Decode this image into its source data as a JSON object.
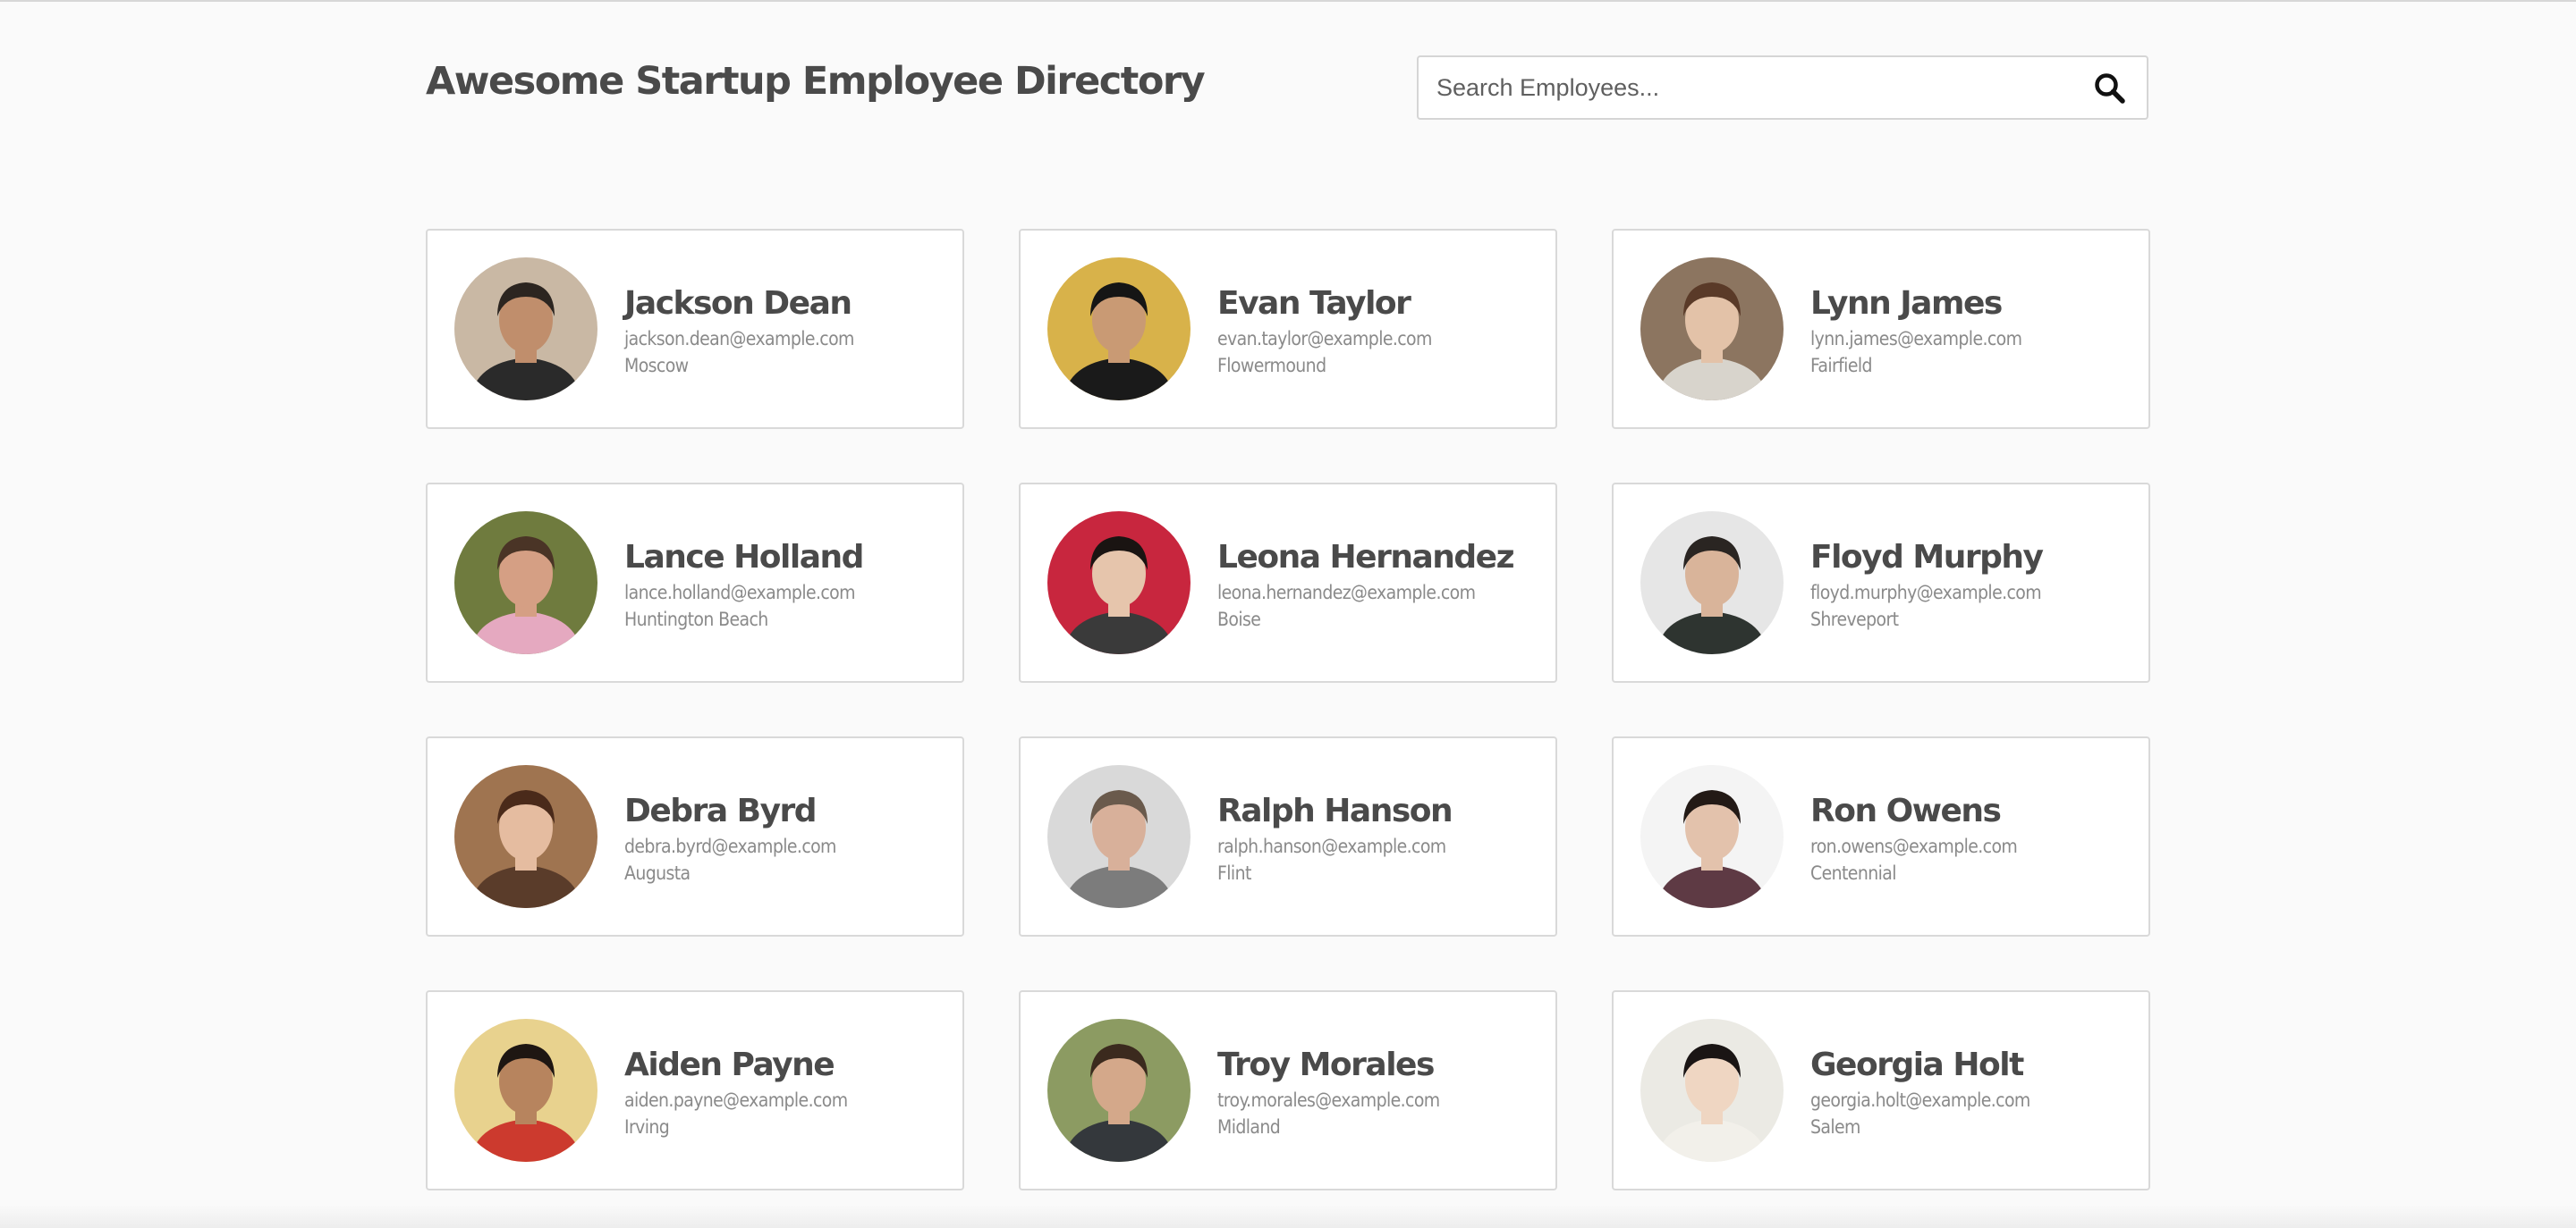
{
  "header": {
    "title": "Awesome Startup Employee Directory"
  },
  "search": {
    "placeholder": "Search Employees...",
    "value": "",
    "icon": "search-icon"
  },
  "employees": [
    {
      "name": "Jackson Dean",
      "email": "jackson.dean@example.com",
      "city": "Moscow",
      "palette": {
        "bg": "#c9b8a4",
        "skin": "#c08e6c",
        "hair": "#2c2520",
        "shirt": "#2a2a2a"
      }
    },
    {
      "name": "Evan Taylor",
      "email": "evan.taylor@example.com",
      "city": "Flowermound",
      "palette": {
        "bg": "#d8b24a",
        "skin": "#c99a74",
        "hair": "#151515",
        "shirt": "#1a1a1a"
      }
    },
    {
      "name": "Lynn James",
      "email": "lynn.james@example.com",
      "city": "Fairfield",
      "palette": {
        "bg": "#8c7560",
        "skin": "#e3c2a8",
        "hair": "#5a3a28",
        "shirt": "#d8d4cc"
      }
    },
    {
      "name": "Lance Holland",
      "email": "lance.holland@example.com",
      "city": "Huntington Beach",
      "palette": {
        "bg": "#6f7b3e",
        "skin": "#d59f84",
        "hair": "#4a3426",
        "shirt": "#e5a9c0"
      }
    },
    {
      "name": "Leona Hernandez",
      "email": "leona.hernandez@example.com",
      "city": "Boise",
      "palette": {
        "bg": "#c8263e",
        "skin": "#e6c5ac",
        "hair": "#1a1412",
        "shirt": "#3a3a3a"
      }
    },
    {
      "name": "Floyd Murphy",
      "email": "floyd.murphy@example.com",
      "city": "Shreveport",
      "palette": {
        "bg": "#e6e6e6",
        "skin": "#d9b49a",
        "hair": "#2a2522",
        "shirt": "#2e3430"
      }
    },
    {
      "name": "Debra Byrd",
      "email": "debra.byrd@example.com",
      "city": "Augusta",
      "palette": {
        "bg": "#9f7450",
        "skin": "#e5bca0",
        "hair": "#4a2a1a",
        "shirt": "#5a3c2a"
      }
    },
    {
      "name": "Ralph Hanson",
      "email": "ralph.hanson@example.com",
      "city": "Flint",
      "palette": {
        "bg": "#d9d9d9",
        "skin": "#d8b09a",
        "hair": "#6a5a4c",
        "shirt": "#7c7c7c"
      }
    },
    {
      "name": "Ron Owens",
      "email": "ron.owens@example.com",
      "city": "Centennial",
      "palette": {
        "bg": "#f4f4f4",
        "skin": "#e3c2ac",
        "hair": "#231a16",
        "shirt": "#5e3a44"
      }
    },
    {
      "name": "Aiden Payne",
      "email": "aiden.payne@example.com",
      "city": "Irving",
      "palette": {
        "bg": "#e8d28e",
        "skin": "#b7845e",
        "hair": "#1e1612",
        "shirt": "#cc3a2e"
      }
    },
    {
      "name": "Troy Morales",
      "email": "troy.morales@example.com",
      "city": "Midland",
      "palette": {
        "bg": "#8c9b62",
        "skin": "#d4a88a",
        "hair": "#3b2a1e",
        "shirt": "#34383c"
      }
    },
    {
      "name": "Georgia Holt",
      "email": "georgia.holt@example.com",
      "city": "Salem",
      "palette": {
        "bg": "#ebeae4",
        "skin": "#efd6c2",
        "hair": "#1a1514",
        "shirt": "#f2f0ea"
      }
    }
  ]
}
